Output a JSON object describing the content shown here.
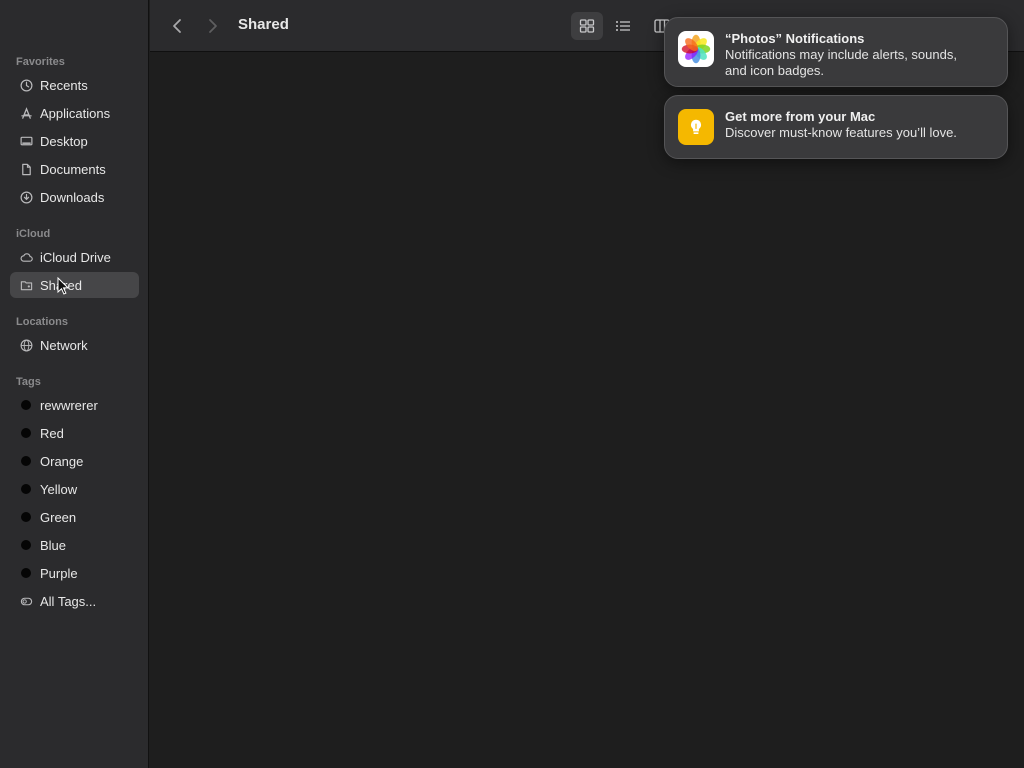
{
  "window": {
    "title": "Shared"
  },
  "sidebar": {
    "favorites": {
      "title": "Favorites",
      "items": [
        {
          "label": "Recents",
          "icon": "clock-icon"
        },
        {
          "label": "Applications",
          "icon": "applications-icon"
        },
        {
          "label": "Desktop",
          "icon": "desktop-icon"
        },
        {
          "label": "Documents",
          "icon": "document-icon"
        },
        {
          "label": "Downloads",
          "icon": "download-icon"
        }
      ]
    },
    "icloud": {
      "title": "iCloud",
      "items": [
        {
          "label": "iCloud Drive",
          "icon": "cloud-icon"
        },
        {
          "label": "Shared",
          "icon": "shared-folder-icon",
          "selected": true
        }
      ]
    },
    "locations": {
      "title": "Locations",
      "items": [
        {
          "label": "Network",
          "icon": "globe-icon"
        }
      ]
    },
    "tags": {
      "title": "Tags",
      "items": [
        {
          "label": "rewwrerer"
        },
        {
          "label": "Red"
        },
        {
          "label": "Orange"
        },
        {
          "label": "Yellow"
        },
        {
          "label": "Green"
        },
        {
          "label": "Blue"
        },
        {
          "label": "Purple"
        },
        {
          "label": "All Tags...",
          "icon": "all-tags-icon"
        }
      ]
    }
  },
  "toolbar": {
    "back_icon": "chevron-left-icon",
    "forward_icon": "chevron-right-icon",
    "views": [
      "icon-view-icon",
      "list-view-icon",
      "column-view-icon"
    ],
    "active_view": "icon-view-icon"
  },
  "notifications": [
    {
      "title": "“Photos” Notifications",
      "body": [
        "Notifications may include alerts, sounds,",
        "and icon badges."
      ],
      "icon": "photos-app-icon"
    },
    {
      "title": "Get more from your Mac",
      "body": [
        "Discover must-know features you’ll love."
      ],
      "icon": "tips-app-icon",
      "icon_color": "#f5b800"
    }
  ],
  "colors": {
    "background": "#1e1e1e",
    "sidebar": "#2b2b2d",
    "selection": "#464648",
    "notification": "#3a3a3c"
  }
}
